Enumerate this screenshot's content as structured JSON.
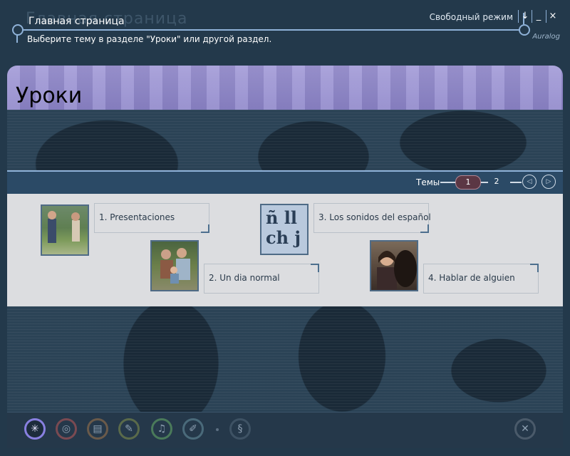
{
  "header": {
    "ghost_title": "Главная страница",
    "title": "Главная страница",
    "subtitle": "Выберите тему в разделе \"Уроки\" или другой раздел.",
    "mode": "Свободный режим",
    "brand": "Auralog",
    "window_buttons": [
      "↓",
      "_",
      "×"
    ]
  },
  "banner": {
    "title": "Уроки"
  },
  "nav": {
    "themes_label": "Темы",
    "pages": [
      "1",
      "2"
    ],
    "active_page": "1",
    "prev_icon": "◁",
    "next_icon": "▷"
  },
  "topics": [
    {
      "label": "1. Presentaciones",
      "thumb": "two-people-photo"
    },
    {
      "label": "2. Un dia normal",
      "thumb": "family-photo"
    },
    {
      "label": "3. Los sonidos del español",
      "thumb": "letters-tile",
      "letters": [
        "ñ ll",
        "ch j"
      ]
    },
    {
      "label": "4. Hablar de alguien",
      "thumb": "two-women-photo"
    }
  ],
  "toolbar": {
    "tools": [
      {
        "name": "lessons",
        "icon": "✳"
      },
      {
        "name": "globe",
        "icon": "◎"
      },
      {
        "name": "book",
        "icon": "▤"
      },
      {
        "name": "edit",
        "icon": "✎"
      },
      {
        "name": "microphone",
        "icon": "♫"
      },
      {
        "name": "pen",
        "icon": "✐"
      },
      {
        "name": "speech",
        "icon": "§"
      },
      {
        "name": "exit",
        "icon": "✕"
      }
    ]
  },
  "colors": {
    "background": "#23394b",
    "banner": "#9a92d4",
    "panel": "#dcdde0",
    "accent_line": "#8fb2d8",
    "active_page": "#5b3744"
  }
}
